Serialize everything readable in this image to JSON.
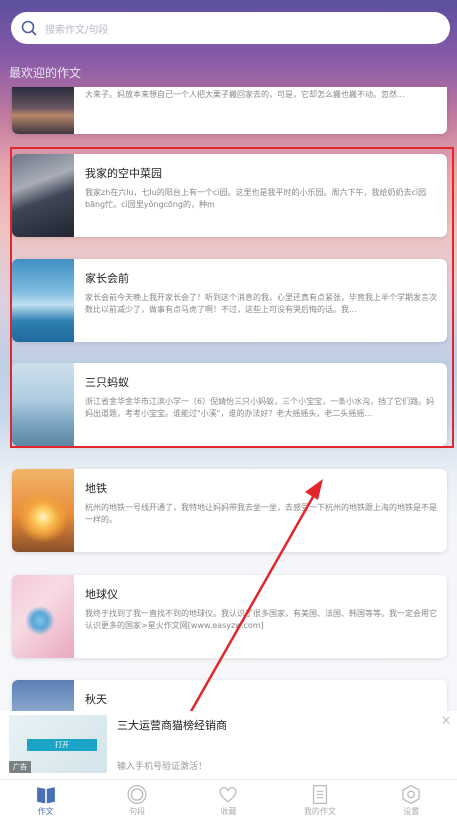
{
  "search": {
    "placeholder": "搜索作文/句段"
  },
  "section_title": "最欢迎的作文",
  "cards": [
    {
      "title": "",
      "desc": "大来子。妈放本来想自己一个人把大栗子搬回家去的，可是，它却怎么搬也搬不动。忽然..."
    },
    {
      "title": "我家的空中菜园",
      "desc": "我家zh在六lu，七lu的阳台上有一个cì园。这里也是我平时的小乐园。周六下午，我给奶奶去cì园bāng忙。cì园里yǒngcōng的，种m"
    },
    {
      "title": "家长会前",
      "desc": "家长会前今天晚上我开家长会了！听到这个消息的我，心里还真有点紧张，毕竟我上半个学期发言次数比以前减少了，做事有点马虎了啊！不过，这些上可没有哭后悔的话。我..."
    },
    {
      "title": "三只蚂蚁",
      "desc": "浙江省金华金华市江滨小学一（6）倪婧怡三只小蚂蚁，三个小宝宝，一条小水沟，挡了它们路。妈妈出道题，考考小宝宝。谁能过\"小溪\"，谁的办法好？老大摇摇头，老二头摇摇..."
    },
    {
      "title": "地铁",
      "desc": "杭州的地铁一号线开通了，我特地让妈妈带我去坐一坐，去感受一下杭州的地铁跟上海的地铁是不是一样的。"
    },
    {
      "title": "地球仪",
      "desc": "我终于找到了我一直找不到的地球仪。我认识了很多国家，有美国、法国、韩国等等。我一定会用它认识更多的国家>星火作文网[www.easyzw.com]"
    },
    {
      "title": "秋天",
      "desc": ""
    }
  ],
  "ad": {
    "title": "三大运营商猫榜经销商",
    "subtitle": "输入手机号验证激活！",
    "tag": "广告",
    "open_label": "打开",
    "close": "×"
  },
  "tabs": [
    {
      "label": "作文",
      "icon": "book-icon",
      "active": true
    },
    {
      "label": "句段",
      "icon": "circle-icon",
      "active": false
    },
    {
      "label": "收藏",
      "icon": "heart-icon",
      "active": false
    },
    {
      "label": "我的作文",
      "icon": "document-icon",
      "active": false
    },
    {
      "label": "设置",
      "icon": "hexagon-icon",
      "active": false
    }
  ],
  "colors": {
    "accent": "#4a6fb5",
    "highlight": "#e2262b",
    "ad_button": "#1aa4c6"
  }
}
